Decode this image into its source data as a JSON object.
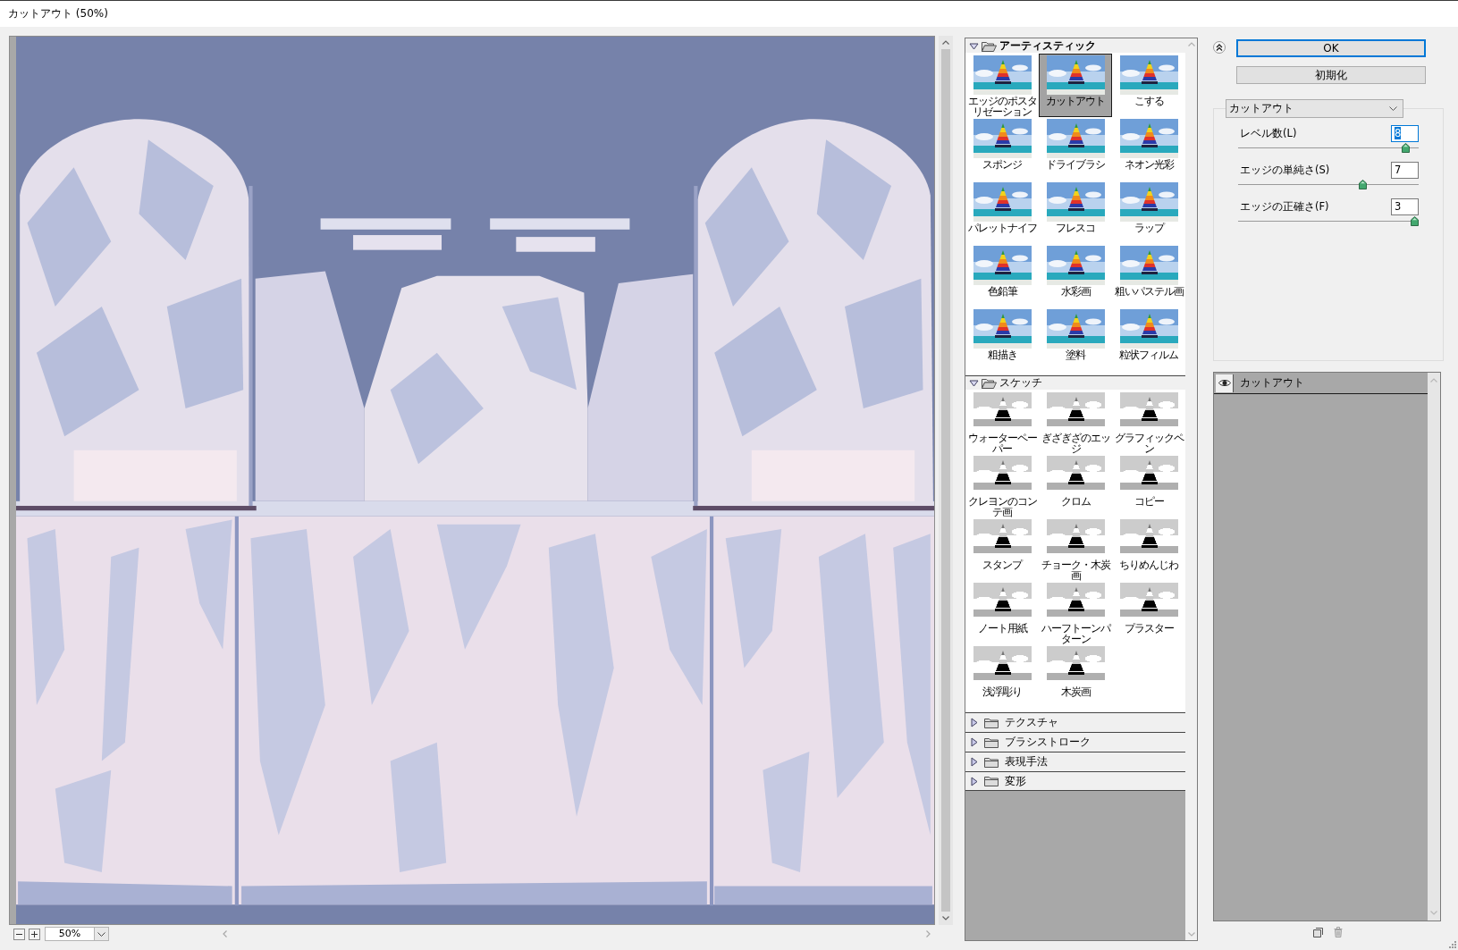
{
  "window": {
    "title": "カットアウト (50%)"
  },
  "preview": {
    "zoom": "50%"
  },
  "filter_gallery": {
    "groups": [
      {
        "label": "アーティスティック",
        "expanded": true,
        "kind": "color",
        "items": [
          {
            "label": "エッジのポスタリゼーション",
            "selected": false
          },
          {
            "label": "カットアウト",
            "selected": true
          },
          {
            "label": "こする",
            "selected": false
          },
          {
            "label": "スポンジ",
            "selected": false
          },
          {
            "label": "ドライブラシ",
            "selected": false
          },
          {
            "label": "ネオン光彩",
            "selected": false
          },
          {
            "label": "パレットナイフ",
            "selected": false
          },
          {
            "label": "フレスコ",
            "selected": false
          },
          {
            "label": "ラップ",
            "selected": false
          },
          {
            "label": "色鉛筆",
            "selected": false
          },
          {
            "label": "水彩画",
            "selected": false
          },
          {
            "label": "粗いパステル画",
            "selected": false
          },
          {
            "label": "粗描き",
            "selected": false
          },
          {
            "label": "塗料",
            "selected": false
          },
          {
            "label": "粒状フィルム",
            "selected": false
          }
        ]
      },
      {
        "label": "スケッチ",
        "expanded": true,
        "kind": "mono",
        "items": [
          {
            "label": "ウォーターペーパー",
            "selected": false
          },
          {
            "label": "ぎざぎざのエッジ",
            "selected": false
          },
          {
            "label": "グラフィックペン",
            "selected": false
          },
          {
            "label": "クレヨンのコンテ画",
            "selected": false
          },
          {
            "label": "クロム",
            "selected": false
          },
          {
            "label": "コピー",
            "selected": false
          },
          {
            "label": "スタンプ",
            "selected": false
          },
          {
            "label": "チョーク・木炭画",
            "selected": false
          },
          {
            "label": "ちりめんじわ",
            "selected": false
          },
          {
            "label": "ノート用紙",
            "selected": false
          },
          {
            "label": "ハーフトーンパターン",
            "selected": false
          },
          {
            "label": "プラスター",
            "selected": false
          },
          {
            "label": "浅浮彫り",
            "selected": false
          },
          {
            "label": "木炭画",
            "selected": false
          }
        ]
      },
      {
        "label": "テクスチャ",
        "expanded": false
      },
      {
        "label": "ブラシストローク",
        "expanded": false
      },
      {
        "label": "表現手法",
        "expanded": false
      },
      {
        "label": "変形",
        "expanded": false
      }
    ]
  },
  "buttons": [
    {
      "label": "OK",
      "default": true
    },
    {
      "label": "初期化",
      "default": false
    }
  ],
  "settings": {
    "filter": "カットアウト",
    "params": [
      {
        "label": "レベル数(L)",
        "value": "8",
        "focused": true,
        "level": 0.95
      },
      {
        "label": "エッジの単純さ(S)",
        "value": "7",
        "focused": false,
        "level": 0.7
      },
      {
        "label": "エッジの正確さ(F)",
        "value": "3",
        "focused": false,
        "level": 1
      }
    ]
  },
  "layers": [
    {
      "label": "カットアウト",
      "visible": true
    }
  ]
}
